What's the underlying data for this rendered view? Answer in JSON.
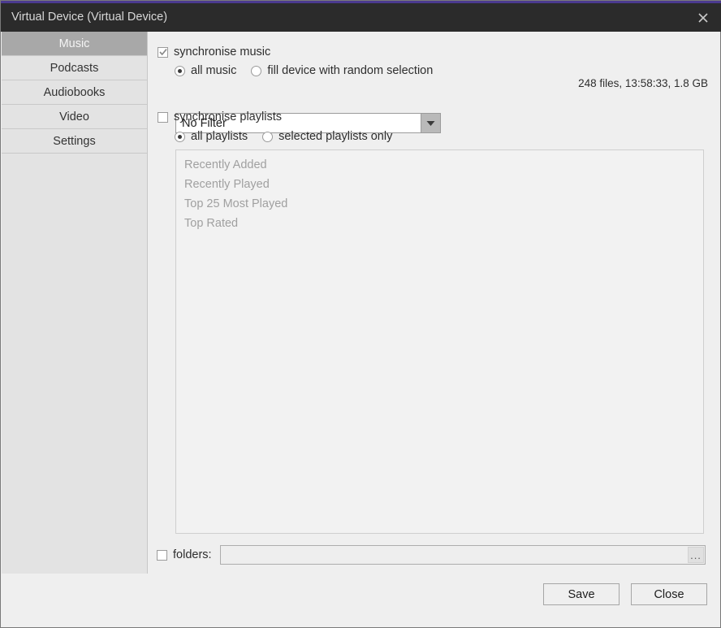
{
  "window": {
    "title": "Virtual Device (Virtual Device)",
    "close_icon": "close-icon",
    "accent_color": "#4b3a8f",
    "titlebar_color": "#2b2b2b"
  },
  "sidebar": {
    "items": [
      {
        "label": "Music",
        "active": true
      },
      {
        "label": "Podcasts",
        "active": false
      },
      {
        "label": "Audiobooks",
        "active": false
      },
      {
        "label": "Video",
        "active": false
      },
      {
        "label": "Settings",
        "active": false
      }
    ]
  },
  "main": {
    "file_info": "248 files, 13:58:33, 1.8 GB",
    "sync_music": {
      "label": "synchronise music",
      "checked": true
    },
    "music_mode": {
      "options": [
        {
          "label": "all music",
          "selected": true
        },
        {
          "label": "fill device with random selection",
          "selected": false
        }
      ]
    },
    "filter": {
      "value": "No Filter",
      "arrow_icon": "chevron-down-icon"
    },
    "sync_playlists": {
      "label": "synchronise playlists",
      "checked": false
    },
    "playlist_mode": {
      "options": [
        {
          "label": "all playlists",
          "selected": true
        },
        {
          "label": "selected playlists only",
          "selected": false
        }
      ]
    },
    "playlists": [
      "Recently Added",
      "Recently Played",
      "Top 25 Most Played",
      "Top Rated"
    ],
    "folders": {
      "label": "folders:",
      "checked": false,
      "value": "",
      "placeholder": "",
      "browse_label": "..."
    }
  },
  "footer": {
    "save_label": "Save",
    "close_label": "Close"
  }
}
